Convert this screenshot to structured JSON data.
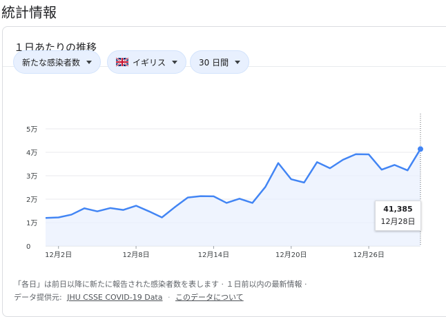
{
  "page": {
    "title": "統計情報"
  },
  "card": {
    "title": "１日あたりの推移"
  },
  "filters": {
    "metric": "新たな感染者数",
    "region": "イギリス",
    "region_flag_icon": "uk-flag-icon",
    "range": "30 日間"
  },
  "tooltip": {
    "value": "41,385",
    "date": "12月28日"
  },
  "footer": {
    "note": "「各日」は前日以降に新たに報告された感染者数を表します · １日前以内の最新情報 ·",
    "source_prefix": "データ提供元:",
    "source_link": "JHU CSSE COVID-19 Data",
    "about_link": "このデータについて"
  },
  "colors": {
    "line": "#4285f4",
    "fill": "#e8f0fe",
    "chip_bg": "#e8f0fe",
    "grid": "#e8eaed"
  },
  "chart_data": {
    "type": "area",
    "y_ticks": [
      "0",
      "1万",
      "2万",
      "3万",
      "4万",
      "5万"
    ],
    "x_ticks": [
      "12月2日",
      "12月8日",
      "12月14日",
      "12月20日",
      "12月26日"
    ],
    "ylim": [
      0,
      50000
    ],
    "grid": true,
    "series": [
      {
        "values": [
          12000,
          12200,
          13400,
          16100,
          14800,
          16200,
          15400,
          17200,
          14800,
          12200,
          16600,
          20700,
          21300,
          21200,
          18400,
          20200,
          18400,
          25200,
          35400,
          28500,
          27100,
          35800,
          33200,
          36800,
          39200,
          39100,
          32600,
          34600,
          32300,
          41385
        ]
      }
    ],
    "highlight": {
      "value": 41385,
      "label": "12月28日"
    }
  }
}
